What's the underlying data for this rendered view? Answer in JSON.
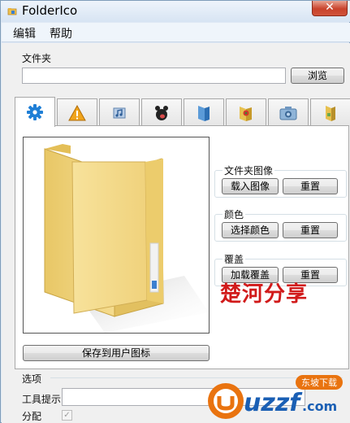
{
  "window": {
    "title": "FolderIco"
  },
  "menu": {
    "items": [
      "编辑",
      "帮助"
    ]
  },
  "folder": {
    "label": "文件夹",
    "value": "",
    "browse_label": "浏览"
  },
  "tabs": [
    {
      "icon": "gear-icon",
      "active": true
    },
    {
      "icon": "warning-icon"
    },
    {
      "icon": "music-icon"
    },
    {
      "icon": "animal-icon"
    },
    {
      "icon": "blue-folder-icon"
    },
    {
      "icon": "flower-folder-icon"
    },
    {
      "icon": "camera-folder-icon"
    },
    {
      "icon": "yellow-folder-icon"
    }
  ],
  "panel": {
    "save_label": "保存到用户图标",
    "folder_image": {
      "title": "文件夹图像",
      "load_label": "载入图像",
      "reset_label": "重置"
    },
    "color": {
      "title": "颜色",
      "choose_label": "选择颜色",
      "reset_label": "重置"
    },
    "overlay": {
      "title": "覆盖",
      "load_label": "加载覆盖",
      "reset_label": "重置"
    },
    "watermark": "楚河分享"
  },
  "options": {
    "label": "选项",
    "tooltip_label": "工具提示",
    "tooltip_value": "",
    "assign_label": "分配",
    "assign_checked": true
  },
  "logo": {
    "text": "uzzf",
    "domain": ".com",
    "badge": "东坡下载"
  },
  "colors": {
    "accent": "#1f7fd6",
    "watermark": "#d11a1a",
    "folder": "#f2d27a"
  }
}
